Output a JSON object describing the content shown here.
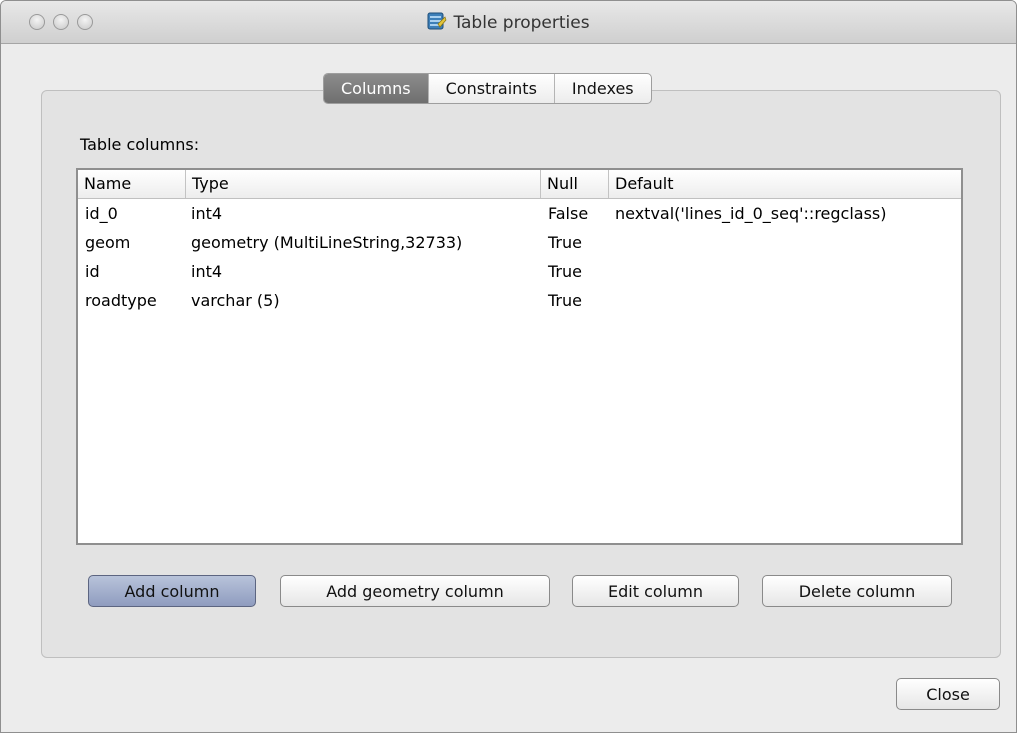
{
  "window": {
    "title": "Table properties"
  },
  "tabs": [
    {
      "label": "Columns",
      "active": true
    },
    {
      "label": "Constraints",
      "active": false
    },
    {
      "label": "Indexes",
      "active": false
    }
  ],
  "section_label": "Table columns:",
  "table": {
    "headers": [
      "Name",
      "Type",
      "Null",
      "Default"
    ],
    "rows": [
      [
        "id_0",
        "int4",
        "False",
        "nextval('lines_id_0_seq'::regclass)"
      ],
      [
        "geom",
        "geometry (MultiLineString,32733)",
        "True",
        ""
      ],
      [
        "id",
        "int4",
        "True",
        ""
      ],
      [
        "roadtype",
        "varchar (5)",
        "True",
        ""
      ]
    ]
  },
  "buttons": {
    "add_column": "Add column",
    "add_geometry_column": "Add geometry column",
    "edit_column": "Edit column",
    "delete_column": "Delete column",
    "close": "Close"
  }
}
